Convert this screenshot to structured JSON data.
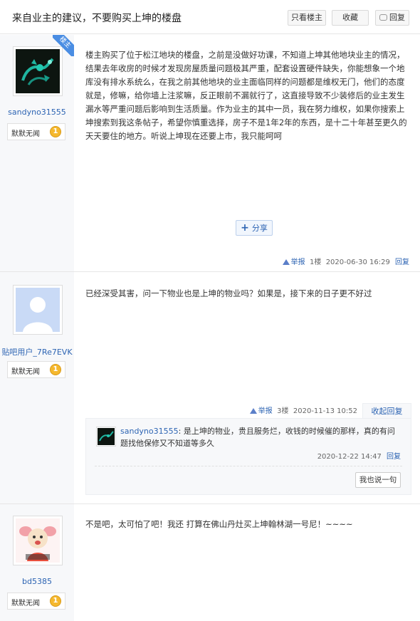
{
  "header": {
    "title": "来自业主的建议，不要购买上坤的楼盘",
    "only_op": "只看楼主",
    "favorite": "收藏",
    "reply": "回复"
  },
  "posts": [
    {
      "user": "sandyno31555",
      "level_name": "默默无闻",
      "level_num": "1",
      "op_badge": "楼主",
      "content": "楼主购买了位于松江地块的楼盘，之前是没做好功课，不知道上坤其他地块业主的情况，结果去年收房的时候才发现房屋质量问题极其严重，配套设置硬件缺失，你能想象一个地库没有排水系统么，在我之前其他地块的业主面临同样的问题都是维权无门，他们的态度就是，修嘛，给你墙上注浆嘛，反正眼前不漏就行了，这直接导致不少装修后的业主发生漏水等严重问题后影响到生活质量。作为业主的其中一员，我在努力维权，如果你搜索上坤搜索到我这条帖子，希望你慎重选择，房子不是1年2年的东西，是十二十年甚至更久的天天要住的地方。听说上坤现在还要上市，我只能呵呵",
      "share": "分享",
      "report": "举报",
      "floor": "1楼",
      "time": "2020-06-30 16:29",
      "reply": "回复",
      "avatar_color": "#1fb5a0"
    },
    {
      "user": "贴吧用户_7Re7EVK",
      "level_name": "默默无闻",
      "level_num": "1",
      "content": "已经深受其害，问一下物业也是上坤的物业吗？如果是，接下来的日子更不好过",
      "report": "举报",
      "floor": "3楼",
      "time": "2020-11-13 10:52",
      "collapse_reply": "收起回复",
      "subreply": {
        "user": "sandyno31555",
        "text": "是上坤的物业，贵且服务烂，收钱的时候催的那样，真的有问题找他保修又不知道等多久",
        "time": "2020-12-22 14:47",
        "reply": "回复",
        "say_btn": "我也说一句"
      }
    },
    {
      "user": "bd5385",
      "level_name": "默默无闻",
      "level_num": "1",
      "content": "不是吧，太可怕了吧！我还 打算在佛山丹灶买上坤翰林湖一号尼！~~~~"
    }
  ],
  "colors": {
    "link": "#2d64b3",
    "op_badge": "#4a8de3",
    "level_badge": "#f5b82e"
  }
}
